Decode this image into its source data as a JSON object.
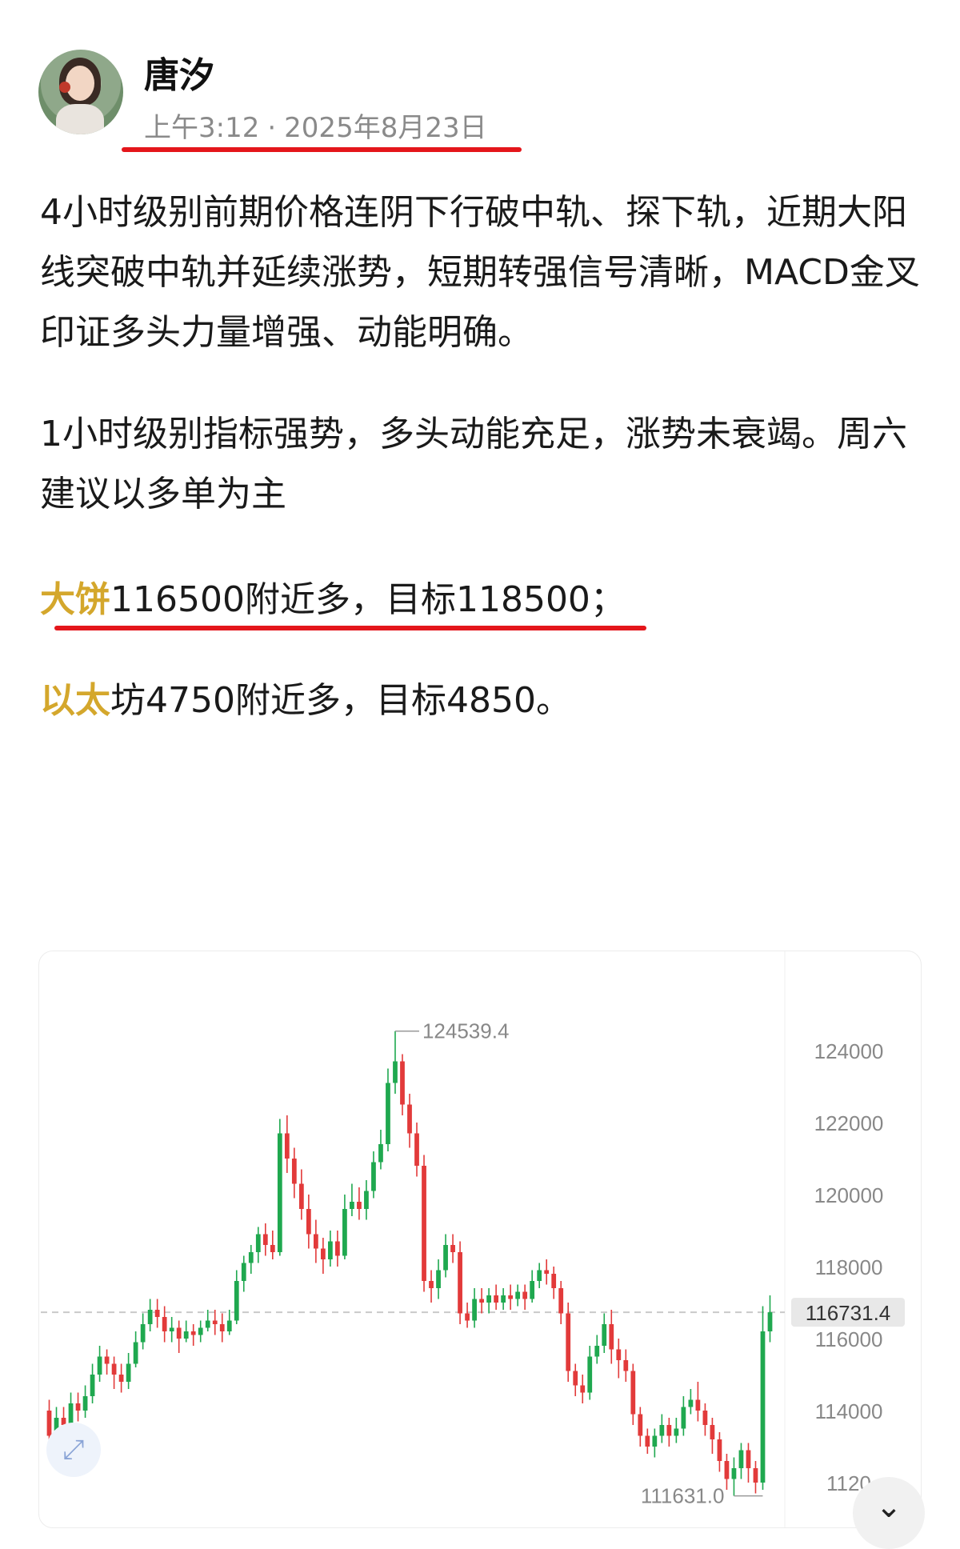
{
  "post": {
    "author": "唐汐",
    "time": "上午3:12",
    "date": "2025年8月23日",
    "paragraphs": [
      "4小时级别前期价格连阴下行破中轨、探下轨，近期大阳线突破中轨并延续涨势，短期转强信号清晰，MACD金叉印证多头力量增强、动能明确。",
      "1小时级别指标强势，多头动能充足，涨势未衰竭。周六建议以多单为主"
    ],
    "btc_line": {
      "coin": "大饼",
      "text": "116500附近多，目标118500；"
    },
    "eth_line": {
      "coin": "以太",
      "text": "坊4750附近多，目标4850。"
    }
  },
  "chart_data": {
    "type": "candlestick",
    "high_label": "124539.4",
    "low_label": "111631.0",
    "current_label": "116731.4",
    "y_ticks": [
      "124000",
      "122000",
      "120000",
      "118000",
      "116000",
      "114000",
      "1120"
    ],
    "ylim": [
      111200,
      125200
    ],
    "current": 116731.4,
    "up_color": "#1fa84f",
    "down_color": "#e23a3a",
    "current_bg": "#e8e8e8",
    "candles": [
      [
        114000,
        113300,
        114300,
        112800
      ],
      [
        113300,
        113800,
        114100,
        112900
      ],
      [
        113800,
        113600,
        114100,
        113300
      ],
      [
        113600,
        114200,
        114500,
        113400
      ],
      [
        114200,
        114000,
        114500,
        113700
      ],
      [
        114000,
        114400,
        114700,
        113800
      ],
      [
        114400,
        115000,
        115300,
        114200
      ],
      [
        115000,
        115500,
        115800,
        114800
      ],
      [
        115500,
        115300,
        115700,
        115000
      ],
      [
        115300,
        115000,
        115500,
        114600
      ],
      [
        115000,
        114800,
        115300,
        114500
      ],
      [
        114800,
        115300,
        115600,
        114600
      ],
      [
        115300,
        115900,
        116200,
        115200
      ],
      [
        115900,
        116400,
        116700,
        115700
      ],
      [
        116400,
        116800,
        117100,
        116200
      ],
      [
        116800,
        116600,
        117100,
        116300
      ],
      [
        116600,
        116200,
        116900,
        115900
      ],
      [
        116200,
        116300,
        116600,
        115900
      ],
      [
        116300,
        116000,
        116500,
        115600
      ],
      [
        116000,
        116200,
        116500,
        115900
      ],
      [
        116200,
        116100,
        116400,
        115800
      ],
      [
        116100,
        116300,
        116500,
        115900
      ],
      [
        116300,
        116500,
        116800,
        116200
      ],
      [
        116500,
        116400,
        116800,
        116100
      ],
      [
        116400,
        116200,
        116700,
        115900
      ],
      [
        116200,
        116500,
        116800,
        116100
      ],
      [
        116500,
        117600,
        117900,
        116400
      ],
      [
        117600,
        118100,
        118300,
        117300
      ],
      [
        118100,
        118400,
        118600,
        117800
      ],
      [
        118400,
        118900,
        119100,
        118100
      ],
      [
        118900,
        118600,
        119200,
        118300
      ],
      [
        118600,
        118400,
        119000,
        118200
      ],
      [
        118400,
        121700,
        122100,
        118300
      ],
      [
        121700,
        121000,
        122200,
        120600
      ],
      [
        121000,
        120300,
        121300,
        119900
      ],
      [
        120300,
        119600,
        120700,
        119300
      ],
      [
        119600,
        118900,
        120000,
        118500
      ],
      [
        118900,
        118500,
        119300,
        118100
      ],
      [
        118500,
        118200,
        118800,
        117800
      ],
      [
        118200,
        118700,
        119000,
        118000
      ],
      [
        118700,
        118300,
        119000,
        118000
      ],
      [
        118300,
        119600,
        120000,
        118200
      ],
      [
        119600,
        119800,
        120300,
        119400
      ],
      [
        119800,
        119600,
        120200,
        119300
      ],
      [
        119600,
        120100,
        120400,
        119300
      ],
      [
        120100,
        120900,
        121200,
        119900
      ],
      [
        120900,
        121400,
        121800,
        120700
      ],
      [
        121400,
        123100,
        123500,
        121200
      ],
      [
        123100,
        123700,
        124539,
        122800
      ],
      [
        123700,
        122500,
        123900,
        122200
      ],
      [
        122500,
        121700,
        122800,
        121300
      ],
      [
        121700,
        120800,
        122000,
        120500
      ],
      [
        120800,
        117600,
        121100,
        117300
      ],
      [
        117600,
        117400,
        117900,
        117000
      ],
      [
        117400,
        117900,
        118200,
        117100
      ],
      [
        117900,
        118600,
        118900,
        117700
      ],
      [
        118600,
        118400,
        118900,
        118100
      ],
      [
        118400,
        116700,
        118700,
        116400
      ],
      [
        116700,
        116500,
        117000,
        116300
      ],
      [
        116500,
        117100,
        117400,
        116300
      ],
      [
        117100,
        117000,
        117400,
        116700
      ],
      [
        117000,
        117200,
        117400,
        116700
      ],
      [
        117200,
        117000,
        117500,
        116800
      ],
      [
        117000,
        117200,
        117400,
        116800
      ],
      [
        117200,
        117100,
        117500,
        116800
      ],
      [
        117100,
        117300,
        117500,
        116900
      ],
      [
        117300,
        117100,
        117500,
        116800
      ],
      [
        117100,
        117600,
        117900,
        117000
      ],
      [
        117600,
        117900,
        118100,
        117400
      ],
      [
        117900,
        117800,
        118200,
        117500
      ],
      [
        117800,
        117400,
        118000,
        117100
      ],
      [
        117400,
        116700,
        117600,
        116400
      ],
      [
        116700,
        115100,
        117000,
        114800
      ],
      [
        115100,
        114700,
        115300,
        114400
      ],
      [
        114700,
        114500,
        115000,
        114200
      ],
      [
        114500,
        115500,
        115800,
        114300
      ],
      [
        115500,
        115800,
        116100,
        115300
      ],
      [
        115800,
        116400,
        116700,
        115600
      ],
      [
        116400,
        115700,
        116800,
        115300
      ],
      [
        115700,
        115400,
        116000,
        114900
      ],
      [
        115400,
        115100,
        115700,
        114800
      ],
      [
        115100,
        113900,
        115300,
        113600
      ],
      [
        113900,
        113300,
        114100,
        113000
      ],
      [
        113300,
        113000,
        113500,
        112800
      ],
      [
        113000,
        113300,
        113500,
        112700
      ],
      [
        113300,
        113600,
        113900,
        113100
      ],
      [
        113600,
        113300,
        113800,
        113000
      ],
      [
        113300,
        113500,
        113800,
        113100
      ],
      [
        113500,
        114100,
        114400,
        113300
      ],
      [
        114100,
        114300,
        114600,
        113900
      ],
      [
        114300,
        114000,
        114800,
        113700
      ],
      [
        114000,
        113600,
        114200,
        113300
      ],
      [
        113600,
        113200,
        113800,
        112800
      ],
      [
        113200,
        112600,
        113400,
        112300
      ],
      [
        112600,
        112100,
        112800,
        111800
      ],
      [
        112100,
        112400,
        112700,
        111631
      ],
      [
        112400,
        112900,
        113100,
        112100
      ],
      [
        112900,
        112400,
        113100,
        112000
      ],
      [
        112400,
        112000,
        112600,
        111700
      ],
      [
        112000,
        116200,
        116900,
        111800
      ],
      [
        116200,
        116731,
        117200,
        115900
      ]
    ]
  }
}
